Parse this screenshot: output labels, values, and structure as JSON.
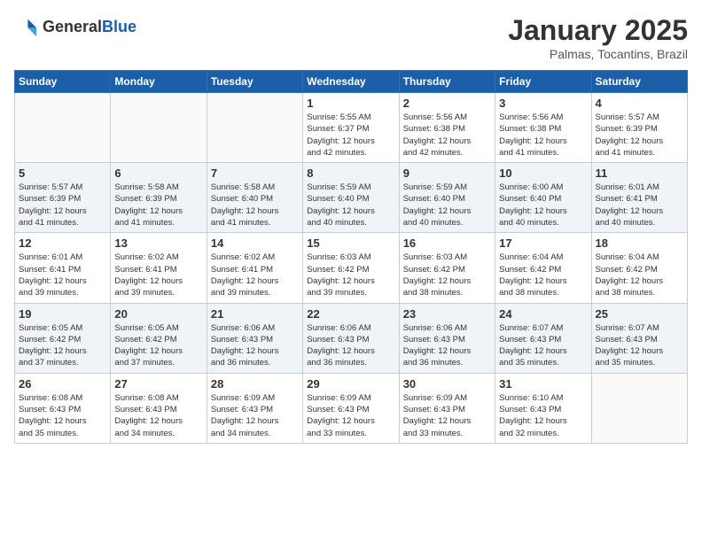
{
  "logo": {
    "text_general": "General",
    "text_blue": "Blue"
  },
  "header": {
    "title": "January 2025",
    "location": "Palmas, Tocantins, Brazil"
  },
  "days_of_week": [
    "Sunday",
    "Monday",
    "Tuesday",
    "Wednesday",
    "Thursday",
    "Friday",
    "Saturday"
  ],
  "weeks": [
    {
      "days": [
        {
          "num": "",
          "info": ""
        },
        {
          "num": "",
          "info": ""
        },
        {
          "num": "",
          "info": ""
        },
        {
          "num": "1",
          "info": "Sunrise: 5:55 AM\nSunset: 6:37 PM\nDaylight: 12 hours\nand 42 minutes."
        },
        {
          "num": "2",
          "info": "Sunrise: 5:56 AM\nSunset: 6:38 PM\nDaylight: 12 hours\nand 42 minutes."
        },
        {
          "num": "3",
          "info": "Sunrise: 5:56 AM\nSunset: 6:38 PM\nDaylight: 12 hours\nand 41 minutes."
        },
        {
          "num": "4",
          "info": "Sunrise: 5:57 AM\nSunset: 6:39 PM\nDaylight: 12 hours\nand 41 minutes."
        }
      ]
    },
    {
      "days": [
        {
          "num": "5",
          "info": "Sunrise: 5:57 AM\nSunset: 6:39 PM\nDaylight: 12 hours\nand 41 minutes."
        },
        {
          "num": "6",
          "info": "Sunrise: 5:58 AM\nSunset: 6:39 PM\nDaylight: 12 hours\nand 41 minutes."
        },
        {
          "num": "7",
          "info": "Sunrise: 5:58 AM\nSunset: 6:40 PM\nDaylight: 12 hours\nand 41 minutes."
        },
        {
          "num": "8",
          "info": "Sunrise: 5:59 AM\nSunset: 6:40 PM\nDaylight: 12 hours\nand 40 minutes."
        },
        {
          "num": "9",
          "info": "Sunrise: 5:59 AM\nSunset: 6:40 PM\nDaylight: 12 hours\nand 40 minutes."
        },
        {
          "num": "10",
          "info": "Sunrise: 6:00 AM\nSunset: 6:40 PM\nDaylight: 12 hours\nand 40 minutes."
        },
        {
          "num": "11",
          "info": "Sunrise: 6:01 AM\nSunset: 6:41 PM\nDaylight: 12 hours\nand 40 minutes."
        }
      ]
    },
    {
      "days": [
        {
          "num": "12",
          "info": "Sunrise: 6:01 AM\nSunset: 6:41 PM\nDaylight: 12 hours\nand 39 minutes."
        },
        {
          "num": "13",
          "info": "Sunrise: 6:02 AM\nSunset: 6:41 PM\nDaylight: 12 hours\nand 39 minutes."
        },
        {
          "num": "14",
          "info": "Sunrise: 6:02 AM\nSunset: 6:41 PM\nDaylight: 12 hours\nand 39 minutes."
        },
        {
          "num": "15",
          "info": "Sunrise: 6:03 AM\nSunset: 6:42 PM\nDaylight: 12 hours\nand 39 minutes."
        },
        {
          "num": "16",
          "info": "Sunrise: 6:03 AM\nSunset: 6:42 PM\nDaylight: 12 hours\nand 38 minutes."
        },
        {
          "num": "17",
          "info": "Sunrise: 6:04 AM\nSunset: 6:42 PM\nDaylight: 12 hours\nand 38 minutes."
        },
        {
          "num": "18",
          "info": "Sunrise: 6:04 AM\nSunset: 6:42 PM\nDaylight: 12 hours\nand 38 minutes."
        }
      ]
    },
    {
      "days": [
        {
          "num": "19",
          "info": "Sunrise: 6:05 AM\nSunset: 6:42 PM\nDaylight: 12 hours\nand 37 minutes."
        },
        {
          "num": "20",
          "info": "Sunrise: 6:05 AM\nSunset: 6:42 PM\nDaylight: 12 hours\nand 37 minutes."
        },
        {
          "num": "21",
          "info": "Sunrise: 6:06 AM\nSunset: 6:43 PM\nDaylight: 12 hours\nand 36 minutes."
        },
        {
          "num": "22",
          "info": "Sunrise: 6:06 AM\nSunset: 6:43 PM\nDaylight: 12 hours\nand 36 minutes."
        },
        {
          "num": "23",
          "info": "Sunrise: 6:06 AM\nSunset: 6:43 PM\nDaylight: 12 hours\nand 36 minutes."
        },
        {
          "num": "24",
          "info": "Sunrise: 6:07 AM\nSunset: 6:43 PM\nDaylight: 12 hours\nand 35 minutes."
        },
        {
          "num": "25",
          "info": "Sunrise: 6:07 AM\nSunset: 6:43 PM\nDaylight: 12 hours\nand 35 minutes."
        }
      ]
    },
    {
      "days": [
        {
          "num": "26",
          "info": "Sunrise: 6:08 AM\nSunset: 6:43 PM\nDaylight: 12 hours\nand 35 minutes."
        },
        {
          "num": "27",
          "info": "Sunrise: 6:08 AM\nSunset: 6:43 PM\nDaylight: 12 hours\nand 34 minutes."
        },
        {
          "num": "28",
          "info": "Sunrise: 6:09 AM\nSunset: 6:43 PM\nDaylight: 12 hours\nand 34 minutes."
        },
        {
          "num": "29",
          "info": "Sunrise: 6:09 AM\nSunset: 6:43 PM\nDaylight: 12 hours\nand 33 minutes."
        },
        {
          "num": "30",
          "info": "Sunrise: 6:09 AM\nSunset: 6:43 PM\nDaylight: 12 hours\nand 33 minutes."
        },
        {
          "num": "31",
          "info": "Sunrise: 6:10 AM\nSunset: 6:43 PM\nDaylight: 12 hours\nand 32 minutes."
        },
        {
          "num": "",
          "info": ""
        }
      ]
    }
  ]
}
